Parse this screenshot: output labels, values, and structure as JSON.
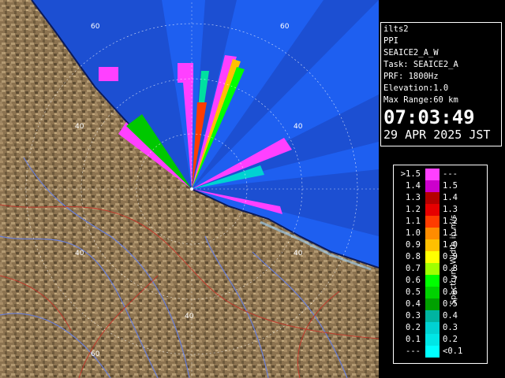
{
  "info": {
    "site": "ilts2",
    "mode": "PPI",
    "scan": "SEAICE2_A_W",
    "task": "Task: SEAICE2_A",
    "prf": "PRF: 1800Hz",
    "elevation": "Elevation:1.0",
    "max_range": "Max Range:60 km",
    "time": "07:03:49",
    "date": "29 APR 2025 JST"
  },
  "legend": {
    "title": "Spectrum Width in m/s",
    "rows": [
      {
        "left": ">1.5",
        "right": "---",
        "color": "#ff40ff"
      },
      {
        "left": "1.4",
        "right": "1.5",
        "color": "#cc00cc"
      },
      {
        "left": "1.3",
        "right": "1.4",
        "color": "#b40000"
      },
      {
        "left": "1.2",
        "right": "1.3",
        "color": "#e60000"
      },
      {
        "left": "1.1",
        "right": "1.2",
        "color": "#ff3c00"
      },
      {
        "left": "1.0",
        "right": "1.1",
        "color": "#ff8c00"
      },
      {
        "left": "0.9",
        "right": "1.0",
        "color": "#ffc000"
      },
      {
        "left": "0.8",
        "right": "0.9",
        "color": "#ffff00"
      },
      {
        "left": "0.7",
        "right": "0.8",
        "color": "#a0ff00"
      },
      {
        "left": "0.6",
        "right": "0.7",
        "color": "#00ff00"
      },
      {
        "left": "0.5",
        "right": "0.6",
        "color": "#00d200"
      },
      {
        "left": "0.4",
        "right": "0.5",
        "color": "#00a000"
      },
      {
        "left": "0.3",
        "right": "0.4",
        "color": "#00b4a0"
      },
      {
        "left": "0.2",
        "right": "0.3",
        "color": "#00d2d2"
      },
      {
        "left": "0.1",
        "right": "0.2",
        "color": "#00e6e6"
      },
      {
        "left": "---",
        "right": "<0.1",
        "color": "#00ffff"
      }
    ]
  },
  "map": {
    "range_labels": [
      "60",
      "60",
      "40",
      "40",
      "40",
      "40",
      "40",
      "60"
    ]
  }
}
